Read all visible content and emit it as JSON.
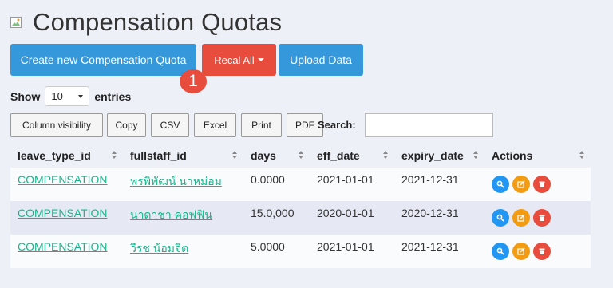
{
  "page": {
    "title": "Compensation Quotas"
  },
  "toolbar": {
    "create_label": "Create new Compensation Quota",
    "recal_label": "Recal All",
    "upload_label": "Upload Data",
    "badge": "1"
  },
  "length": {
    "show": "Show",
    "value": "10",
    "entries": "entries"
  },
  "export": {
    "colvis": "Column visibility",
    "copy": "Copy",
    "csv": "CSV",
    "excel": "Excel",
    "print": "Print",
    "pdf": "PDF",
    "search_label": "Search:",
    "search_value": ""
  },
  "table": {
    "columns": [
      "leave_type_id",
      "fullstaff_id",
      "days",
      "eff_date",
      "expiry_date",
      "Actions"
    ],
    "rows": [
      {
        "leave_type_id": "COMPENSATION",
        "fullstaff_id": "พรพิพัฒน์ นาหม่อม",
        "days": "0.0000",
        "eff_date": "2021-01-01",
        "expiry_date": "2021-12-31"
      },
      {
        "leave_type_id": "COMPENSATION",
        "fullstaff_id": "นาดาชา คอฟฟิน",
        "days": "15.0,000",
        "eff_date": "2020-01-01",
        "expiry_date": "2020-12-31"
      },
      {
        "leave_type_id": "COMPENSATION",
        "fullstaff_id": "วีรช น้อมจิต",
        "days": "5.0000",
        "eff_date": "2021-01-01",
        "expiry_date": "2021-12-31"
      }
    ]
  },
  "colors": {
    "primary": "#3498db",
    "danger": "#e74c3c",
    "warning": "#f39c12",
    "info": "#2196f3",
    "link": "#18b58b"
  },
  "icons": {
    "view": "search-icon",
    "edit": "edit-icon",
    "delete": "trash-icon",
    "title": "broken-image-icon"
  }
}
